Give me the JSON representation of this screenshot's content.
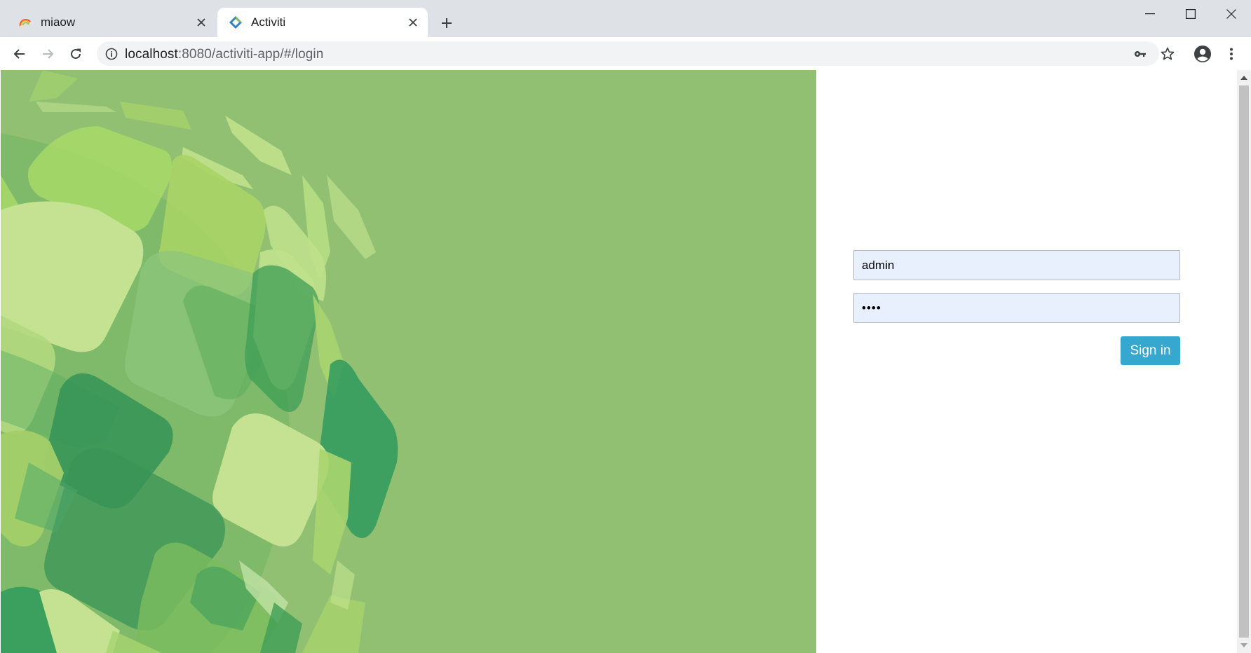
{
  "browser": {
    "tabs": [
      {
        "title": "miaow",
        "favicon": "rainbow-icon",
        "active": false
      },
      {
        "title": "Activiti",
        "favicon": "activiti-diamond-icon",
        "active": true
      }
    ],
    "url": {
      "host": "localhost",
      "path": ":8080/activiti-app/#/login"
    },
    "toolbar_icons": [
      "back-arrow-icon",
      "forward-arrow-icon",
      "reload-icon",
      "info-icon",
      "key-icon",
      "star-icon",
      "account-icon",
      "kebab-menu-icon"
    ],
    "window_controls": [
      "minimize-icon",
      "maximize-icon",
      "close-icon"
    ]
  },
  "login": {
    "username_value": "admin",
    "password_mask": "••••",
    "signin_label": "Sign in"
  },
  "colors": {
    "hero_background": "#91c073",
    "button": "#36a7cf",
    "input_background": "#e8f0fe"
  }
}
